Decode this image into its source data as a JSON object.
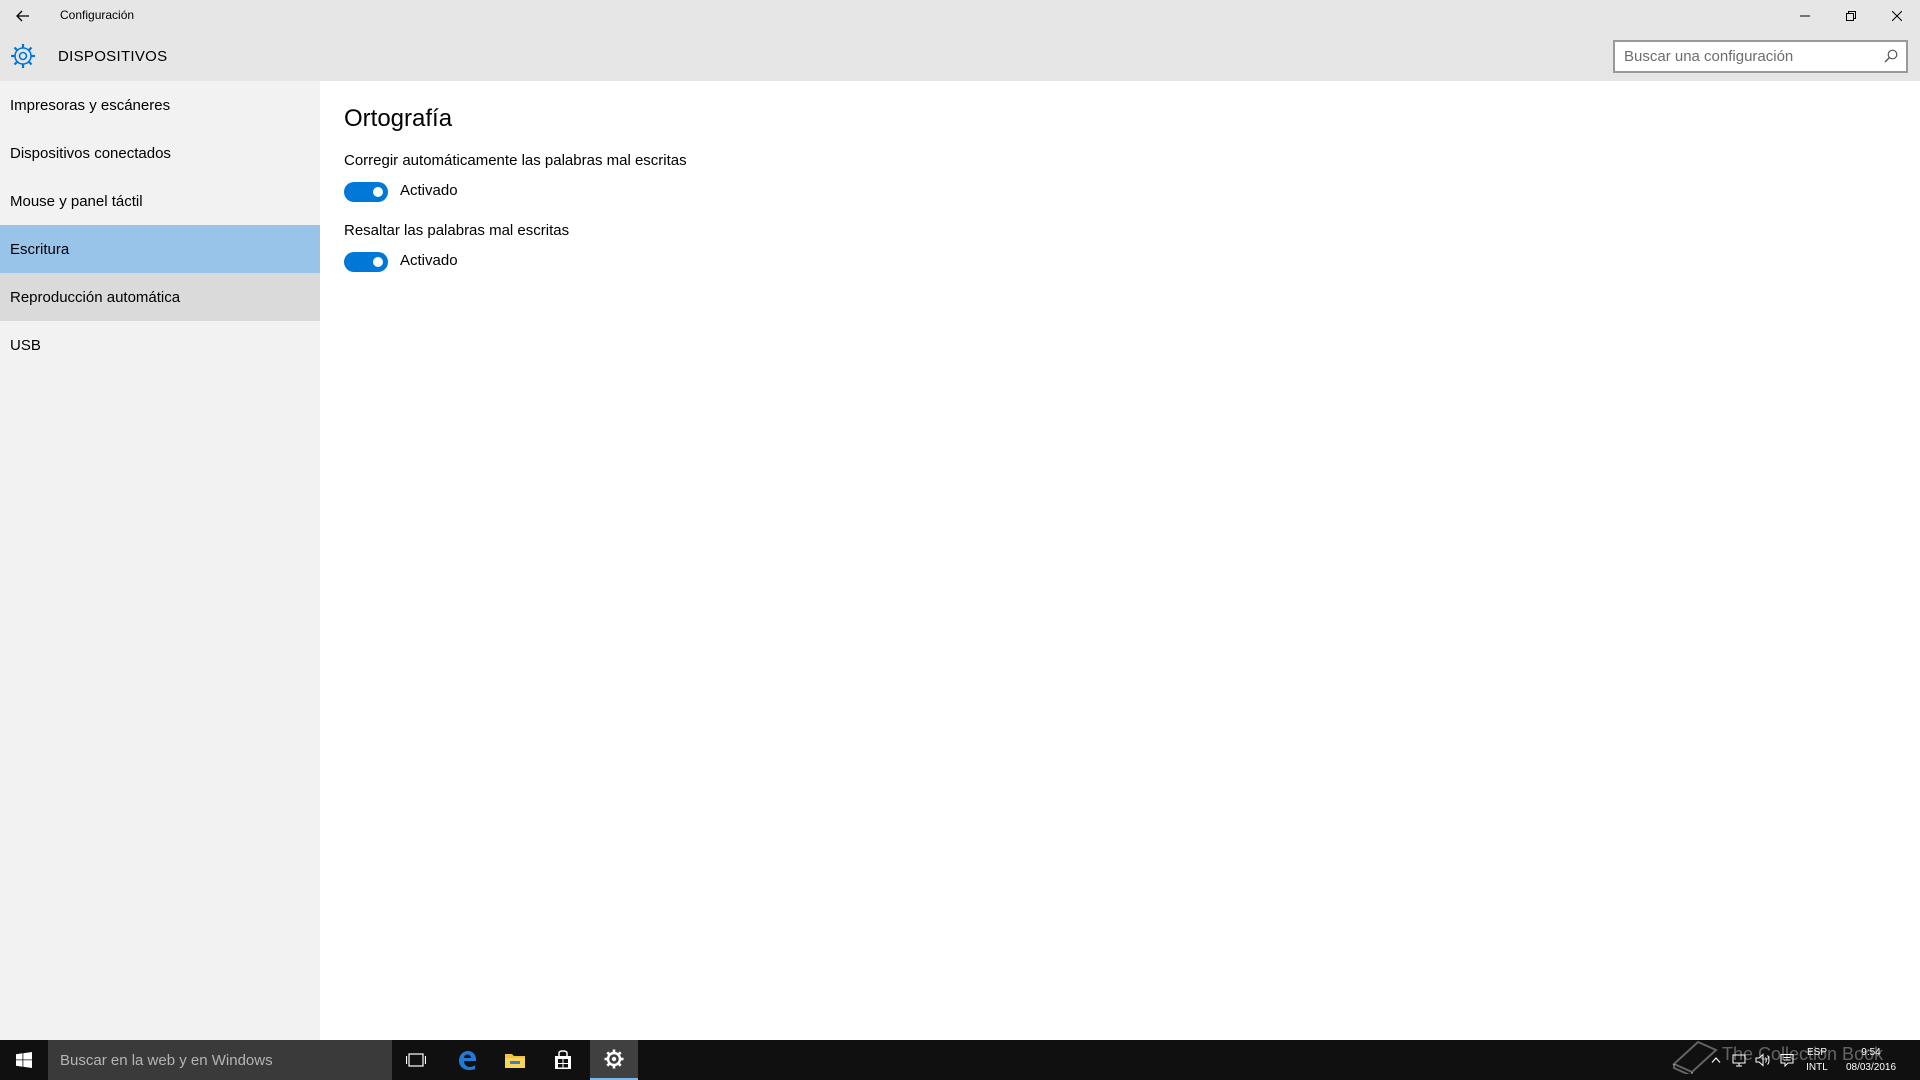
{
  "window": {
    "title": "Configuración",
    "back_icon": "back-arrow-icon",
    "minimize_icon": "minimize-icon",
    "maximize_icon": "restore-icon",
    "close_icon": "close-icon"
  },
  "header": {
    "icon": "gear-icon",
    "section_title": "DISPOSITIVOS",
    "search_placeholder": "Buscar una configuración",
    "search_icon": "search-icon"
  },
  "sidebar": {
    "items": [
      {
        "label": "Impresoras y escáneres",
        "state": "normal"
      },
      {
        "label": "Dispositivos conectados",
        "state": "normal"
      },
      {
        "label": "Mouse y panel táctil",
        "state": "normal"
      },
      {
        "label": "Escritura",
        "state": "selected"
      },
      {
        "label": "Reproducción automática",
        "state": "hover"
      },
      {
        "label": "USB",
        "state": "normal"
      }
    ]
  },
  "content": {
    "heading": "Ortografía",
    "settings": [
      {
        "label": "Corregir automáticamente las palabras mal escritas",
        "toggle_state": "on",
        "toggle_text": "Activado"
      },
      {
        "label": "Resaltar las palabras mal escritas",
        "toggle_state": "on",
        "toggle_text": "Activado"
      }
    ]
  },
  "taskbar": {
    "start_icon": "windows-logo-icon",
    "search_placeholder": "Buscar en la web y en Windows",
    "pinned": [
      {
        "icon": "task-view-icon",
        "active": false
      },
      {
        "icon": "edge-icon",
        "active": false
      },
      {
        "icon": "file-explorer-icon",
        "active": false
      },
      {
        "icon": "store-icon",
        "active": false
      },
      {
        "icon": "settings-gear-icon",
        "active": true
      }
    ],
    "tray": {
      "language_top": "ESP",
      "language_bottom": "INTL",
      "time": "9:54",
      "date": "08/03/2016"
    },
    "watermark": "The Collection Book"
  },
  "colors": {
    "accent": "#0078d7",
    "selected_nav": "#99c4ea",
    "hover_nav": "#dadada",
    "header_bg": "#e6e6e6",
    "sidebar_bg": "#f2f2f2",
    "taskbar_bg": "#101010"
  }
}
